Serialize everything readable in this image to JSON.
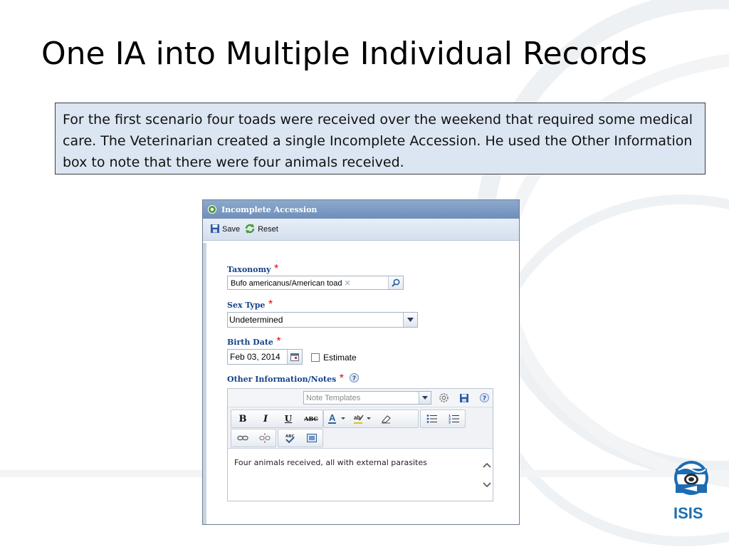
{
  "slide": {
    "title": "One IA into Multiple Individual Records",
    "description": "For the first scenario four toads were received over the weekend that required some medical care. The Veterinarian created a single Incomplete Accession. He used the Other Information box to note that there were four animals received."
  },
  "dialog": {
    "title": "Incomplete Accession",
    "toolbar": {
      "save_label": "Save",
      "reset_label": "Reset"
    },
    "taxonomy": {
      "label": "Taxonomy",
      "required": "*",
      "value": "Bufo americanus/American toad"
    },
    "sex_type": {
      "label": "Sex Type",
      "required": "*",
      "value": "Undetermined"
    },
    "birth_date": {
      "label": "Birth Date",
      "required": "*",
      "value": "Feb 03, 2014",
      "estimate_label": "Estimate",
      "estimate_checked": false
    },
    "other_info": {
      "label": "Other Information/Notes",
      "required": "*",
      "template_placeholder": "Note Templates",
      "format": {
        "bold": "B",
        "italic": "I",
        "underline": "U",
        "strike": "ABC"
      },
      "text": "Four animals received, all with external parasites"
    }
  },
  "logo": {
    "text": "ISIS"
  },
  "colors": {
    "desc_bg": "#dce6f2",
    "dialog_title_bg": "#7c9cc4",
    "field_label": "#15428b",
    "required": "#ee0000",
    "logo_blue": "#1a6fb5"
  },
  "icons": [
    "gear-icon",
    "save-icon",
    "reset-icon",
    "search-icon",
    "chevron-down-icon",
    "calendar-icon",
    "help-icon",
    "settings-icon",
    "font-color-icon",
    "highlight-icon",
    "eraser-icon",
    "bullet-list-icon",
    "numbered-list-icon",
    "link-icon",
    "unlink-icon",
    "spellcheck-icon",
    "source-icon",
    "chevron-up-icon"
  ]
}
